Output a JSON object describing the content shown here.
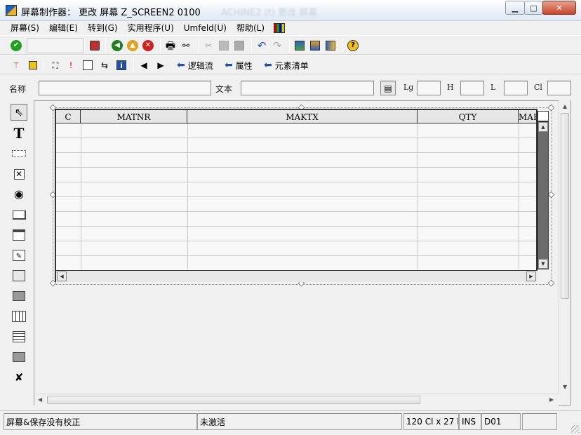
{
  "window": {
    "title": "屏幕制作器： 更改 屏幕 Z_SCREEN2 0100",
    "ghost_title": "ACHINE2 (t) 更改 屏幕"
  },
  "menu": [
    {
      "label": "屏幕(S)"
    },
    {
      "label": "编辑(E)"
    },
    {
      "label": "转到(G)"
    },
    {
      "label": "实用程序(U)"
    },
    {
      "label": "Umfeld(U)"
    },
    {
      "label": "帮助(L)"
    }
  ],
  "toolbar2": {
    "logic_flow": "逻辑流",
    "attributes": "属性",
    "element_list": "元素清单"
  },
  "fields": {
    "name_label": "名称",
    "text_label": "文本",
    "name_value": "",
    "text_value": "",
    "lg_label": "Lg",
    "h_label": "H",
    "l_label": "L",
    "cl_label": "Cl",
    "lg_value": "",
    "h_value": "",
    "l_value": "",
    "cl_value": ""
  },
  "table": {
    "columns": [
      "C",
      "MATNR",
      "MAKTX",
      "QTY",
      "MAR"
    ],
    "visible_rows": 10
  },
  "status": {
    "message": "屏幕&保存没有校正",
    "activation": "未激活",
    "size": "120 Cl x 27 L",
    "mode": "INS",
    "client": "D01",
    "extra": ""
  },
  "colors": {
    "title_gradient_top": "#ffffff",
    "title_gradient_bottom": "#dfe8f3",
    "window_bg": "#f0f0f0",
    "close_button": "#c8442a",
    "ok_check": "#20a020",
    "back_green": "#208020",
    "cancel_red": "#d02020",
    "exit_yellow": "#e0a020",
    "help_yellow": "#f0c020",
    "arrow_blue": "#2050b0",
    "table_scroll_dark": "#6c6c6c"
  }
}
